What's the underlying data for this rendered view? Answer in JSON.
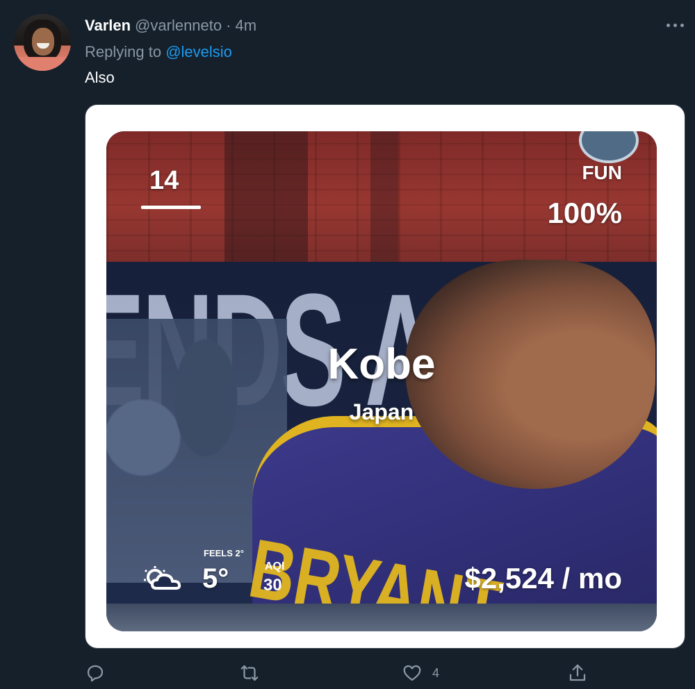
{
  "tweet": {
    "display_name": "Varlen",
    "handle": "@varlenneto",
    "separator": "·",
    "time": "4m",
    "replying_prefix": "Replying to",
    "replying_to": "@levelsio",
    "text": "Also"
  },
  "card": {
    "rank": "14",
    "fun_label": "FUN",
    "fun_value": "100%",
    "city": "Kobe",
    "country": "Japan",
    "weather_icon": "cloud-sun-icon",
    "feels_like": "FEELS 2°",
    "temperature": "5°",
    "aqi_label": "AQI",
    "aqi_value": "30",
    "cost": "$2,524 / mo",
    "photo_banner_text": "ENDS ARE L",
    "photo_jersey_text": "BRYANT"
  },
  "actions": {
    "reply_count": "",
    "retweet_count": "",
    "like_count": "4"
  },
  "colors": {
    "background": "#15202b",
    "muted": "#8b98a5",
    "link": "#1d9bf0"
  }
}
